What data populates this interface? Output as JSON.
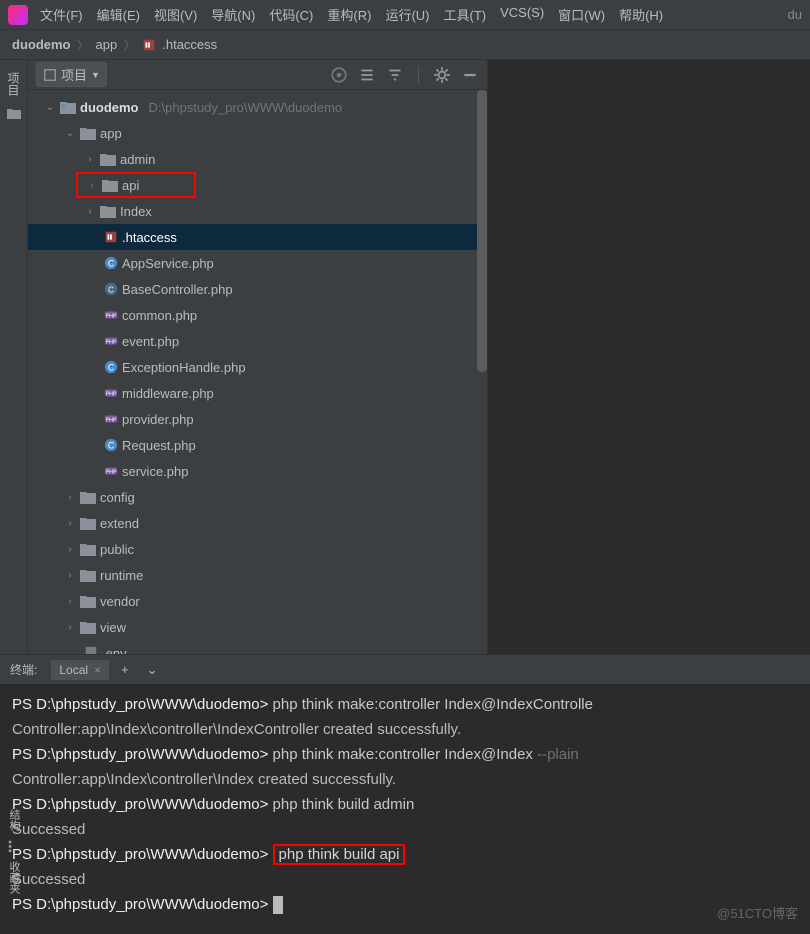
{
  "titlebar": {
    "right_hint": "du"
  },
  "menu": {
    "file": "文件(F)",
    "edit": "编辑(E)",
    "view": "视图(V)",
    "nav": "导航(N)",
    "code": "代码(C)",
    "refactor": "重构(R)",
    "run": "运行(U)",
    "tools": "工具(T)",
    "vcs": "VCS(S)",
    "window": "窗口(W)",
    "help": "帮助(H)"
  },
  "breadcrumb": {
    "root": "duodemo",
    "dir": "app",
    "file": ".htaccess"
  },
  "sidebar": {
    "project_vert": "项目",
    "structure_vert": "结构",
    "favorites_vert": "收藏夹"
  },
  "panel": {
    "title": "项目"
  },
  "tree": {
    "root": {
      "name": "duodemo",
      "path": "D:\\phpstudy_pro\\WWW\\duodemo"
    },
    "app": "app",
    "folders_top": [
      "admin",
      "api",
      "Index"
    ],
    "selected_file": ".htaccess",
    "files": [
      "AppService.php",
      "BaseController.php",
      "common.php",
      "event.php",
      "ExceptionHandle.php",
      "middleware.php",
      "provider.php",
      "Request.php",
      "service.php"
    ],
    "folders_bottom": [
      "config",
      "extend",
      "public",
      "runtime",
      "vendor",
      "view"
    ],
    "env": ".env"
  },
  "terminal": {
    "tab_label": "终端:",
    "tab_name": "Local",
    "prompt": "PS D:\\phpstudy_pro\\WWW\\duodemo>",
    "lines": [
      {
        "type": "cmd",
        "text": "php think make:controller Index@IndexControlle"
      },
      {
        "type": "out",
        "text": "Controller:app\\Index\\controller\\IndexController created successfully."
      },
      {
        "type": "cmd",
        "text": "php think make:controller Index@Index",
        "flag": "--plain"
      },
      {
        "type": "out",
        "text": "Controller:app\\Index\\controller\\Index created successfully."
      },
      {
        "type": "cmd",
        "text": "php think build admin"
      },
      {
        "type": "out",
        "text": "Successed"
      },
      {
        "type": "cmd",
        "text": "php think build api",
        "boxed": true
      },
      {
        "type": "out",
        "text": "Successed"
      },
      {
        "type": "cursor"
      }
    ]
  },
  "watermark": "@51CTO博客"
}
